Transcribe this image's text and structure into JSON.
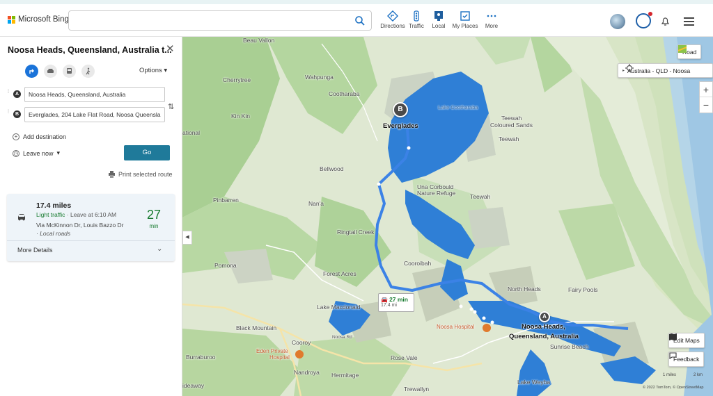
{
  "brand": {
    "name": "Microsoft Bing",
    "colors": [
      "#f25022",
      "#7fba00",
      "#00a4ef",
      "#ffb900"
    ]
  },
  "search": {
    "placeholder": ""
  },
  "nav": {
    "directions": "Directions",
    "traffic": "Traffic",
    "local": "Local",
    "my_places": "My Places",
    "more": "More"
  },
  "panel": {
    "title": "Noosa Heads, Queensland, Australia t...",
    "options": "Options",
    "waypoint_a": {
      "marker": "A",
      "value": "Noosa Heads, Queensland, Australia"
    },
    "waypoint_b": {
      "marker": "B",
      "value": "Everglades, 204 Lake Flat Road, Noosa Queensla"
    },
    "add_destination": "Add destination",
    "leave_now": "Leave now",
    "go": "Go",
    "print": "Print selected route"
  },
  "route": {
    "distance": "17.4 miles",
    "traffic_label": "Light traffic",
    "leave_at": " · Leave at 6:10 AM",
    "via": "Via McKinnon Dr, Louis Bazzo Dr",
    "roads": "Local roads",
    "minutes": "27",
    "min_label": "min",
    "more_details": "More Details"
  },
  "map": {
    "layer_button": "Road",
    "breadcrumb": "Australia - QLD - Noosa",
    "edit_maps": "Edit Maps",
    "feedback": "Feedback",
    "route_time": "27 min",
    "route_dist": "17.4 mi",
    "pin_a": "A",
    "pin_b": "B",
    "copyright": "© 2022 TomTom, © OpenStreetMap",
    "scale_miles": "1 miles",
    "scale_km": "2 km",
    "labels": {
      "beau_vallon": "Beau Vallon",
      "wahpunga": "Wahpunga",
      "cherrytree": "Cherrytree",
      "cootharaba": "Cootharaba",
      "lake_cootharaba": "Lake Cootharaba",
      "kin_kin": "Kin Kin",
      "teewah": "Teewah",
      "coloured_sands": "Coloured Sands",
      "teewah2": "Teewah",
      "everglades": "Everglades",
      "national": "ational",
      "bellwood": "Bellwood",
      "una_corbould": "Una Corbould",
      "nature_refuge": "Nature Refuge",
      "teewah3": "Teewah",
      "pinbarren": "Pinbarren",
      "nana": "Nan'a",
      "ringtail_creek": "Ringtail Creek",
      "cooroibah": "Cooroibah",
      "pomona": "Pomona",
      "forest_acres": "Forest Acres",
      "north_heads": "North Heads",
      "fairy_pools": "Fairy Pools",
      "lake_macdonald": "Lake Macdonald",
      "noosa_hospital": "Noosa Hospital",
      "noosa_heads": "Noosa Heads,",
      "queensland": "Queensland, Australia",
      "sunrise_beach": "Sunrise Beach",
      "black_mountain": "Black Mountain",
      "cooroy": "Cooroy",
      "eden_private": "Eden Private",
      "hospital": "Hospital",
      "burraburoo": "Burraburoo",
      "rose_vale": "Rose Vale",
      "nandroya": "Nandroya",
      "hermitage": "Hermitage",
      "trewallyn": "Trewallyn",
      "lake_weyba": "Lake Weyba",
      "ideaway": "ideaway",
      "pomona_rd": "Pomona",
      "lake_macdonald_dr": "Noosa Rd"
    }
  }
}
